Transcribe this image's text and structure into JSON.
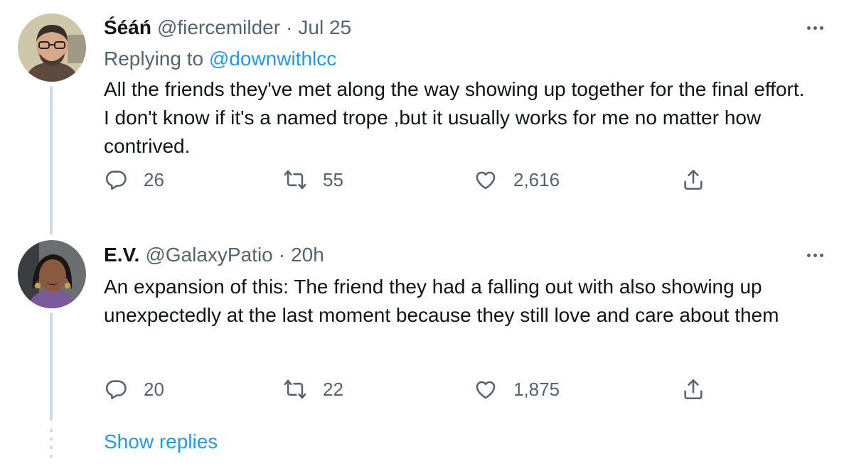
{
  "tweets": [
    {
      "name": "Śéáń",
      "handle": "@fiercemilder",
      "separator": "·",
      "time": "Jul 25",
      "replying_prefix": "Replying to",
      "replying_to": "@downwithlcc",
      "text": "All the friends they've met along the way showing up together for the final effort. I don't know if it's a named trope ,but it usually works for me no matter how contrived.",
      "stats": {
        "replies": "26",
        "retweets": "55",
        "likes": "2,616"
      }
    },
    {
      "name": "E.V.",
      "handle": "@GalaxyPatio",
      "separator": "·",
      "time": "20h",
      "text": "An expansion of this: The friend they had a falling out with also showing up unexpectedly at the last moment because they still love and care about them",
      "stats": {
        "replies": "20",
        "retweets": "22",
        "likes": "1,875"
      }
    }
  ],
  "show_replies_label": "Show replies",
  "colors": {
    "text": "#0f1419",
    "secondary": "#536471",
    "accent": "#1d9bf0",
    "thread_line": "#cfd9de"
  },
  "icons": [
    "reply-icon",
    "retweet-icon",
    "like-icon",
    "share-icon",
    "more-icon"
  ]
}
